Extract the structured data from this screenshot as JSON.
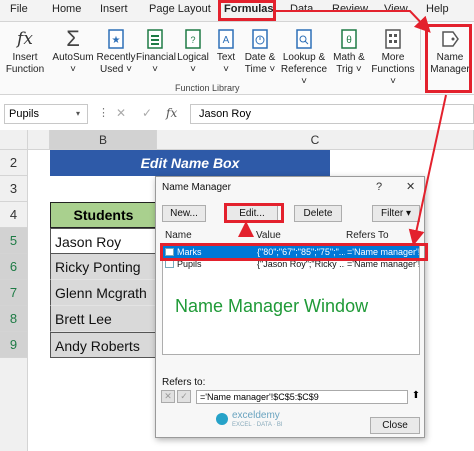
{
  "menu": {
    "tabs": [
      "File",
      "Home",
      "Insert",
      "Page Layout",
      "Formulas",
      "Data",
      "Review",
      "View",
      "Help"
    ],
    "active_tab": "Formulas"
  },
  "ribbon": {
    "buttons": [
      {
        "label1": "Insert",
        "label2": "Function",
        "icon": "fx-icon"
      },
      {
        "label1": "AutoSum",
        "label2": "˅",
        "icon": "sigma-icon"
      },
      {
        "label1": "Recently",
        "label2": "Used ˅",
        "icon": "star-book-icon"
      },
      {
        "label1": "Financial",
        "label2": "˅",
        "icon": "financial-book-icon"
      },
      {
        "label1": "Logical",
        "label2": "˅",
        "icon": "logical-book-icon"
      },
      {
        "label1": "Text",
        "label2": "˅",
        "icon": "text-book-icon"
      },
      {
        "label1": "Date &",
        "label2": "Time ˅",
        "icon": "date-time-book-icon"
      },
      {
        "label1": "Lookup &",
        "label2": "Reference ˅",
        "icon": "lookup-book-icon"
      },
      {
        "label1": "Math &",
        "label2": "Trig ˅",
        "icon": "math-book-icon"
      },
      {
        "label1": "More",
        "label2": "Functions ˅",
        "icon": "more-functions-icon"
      },
      {
        "label1": "Name",
        "label2": "Manager",
        "icon": "name-manager-icon"
      }
    ],
    "group_label": "Function Library"
  },
  "formula_bar": {
    "name_box": "Pupils",
    "fx": "fx",
    "value": "Jason Roy"
  },
  "sheet": {
    "col_b": "B",
    "col_c": "C",
    "rows": [
      "2",
      "3",
      "4",
      "5",
      "6",
      "7",
      "8",
      "9"
    ],
    "title": "Edit Name Box",
    "header": "Students",
    "students": [
      "Jason Roy",
      "Ricky Ponting",
      "Glenn Mcgrath",
      "Brett Lee",
      "Andy Roberts"
    ]
  },
  "dialog": {
    "title": "Name Manager",
    "help": "?",
    "close_x": "✕",
    "new": "New...",
    "edit": "Edit...",
    "delete": "Delete",
    "filter": "Filter ▾",
    "headers": [
      "Name",
      "Value",
      "Refers To"
    ],
    "rows": [
      {
        "name": "Marks",
        "value": "{\"80\";\"67\";\"85\";\"75\";\"...",
        "refers": "='Name manager'!..."
      },
      {
        "name": "Pupils",
        "value": "{\"Jason Roy\";\"Ricky ...",
        "refers": "='Name manager'!..."
      }
    ],
    "annotation": "Name Manager Window",
    "refers_to_label": "Refers to:",
    "refers_to_value": "='Name manager'!$C$5:$C$9",
    "close": "Close",
    "watermark": "exceldemy",
    "watermark_sub": "EXCEL · DATA · BI"
  },
  "colors": {
    "accent_red": "#e3212d",
    "title_blue": "#2e5aa8",
    "header_green": "#a9d08e",
    "selection_blue": "#0078d7",
    "annotation_green": "#1f9a37"
  }
}
